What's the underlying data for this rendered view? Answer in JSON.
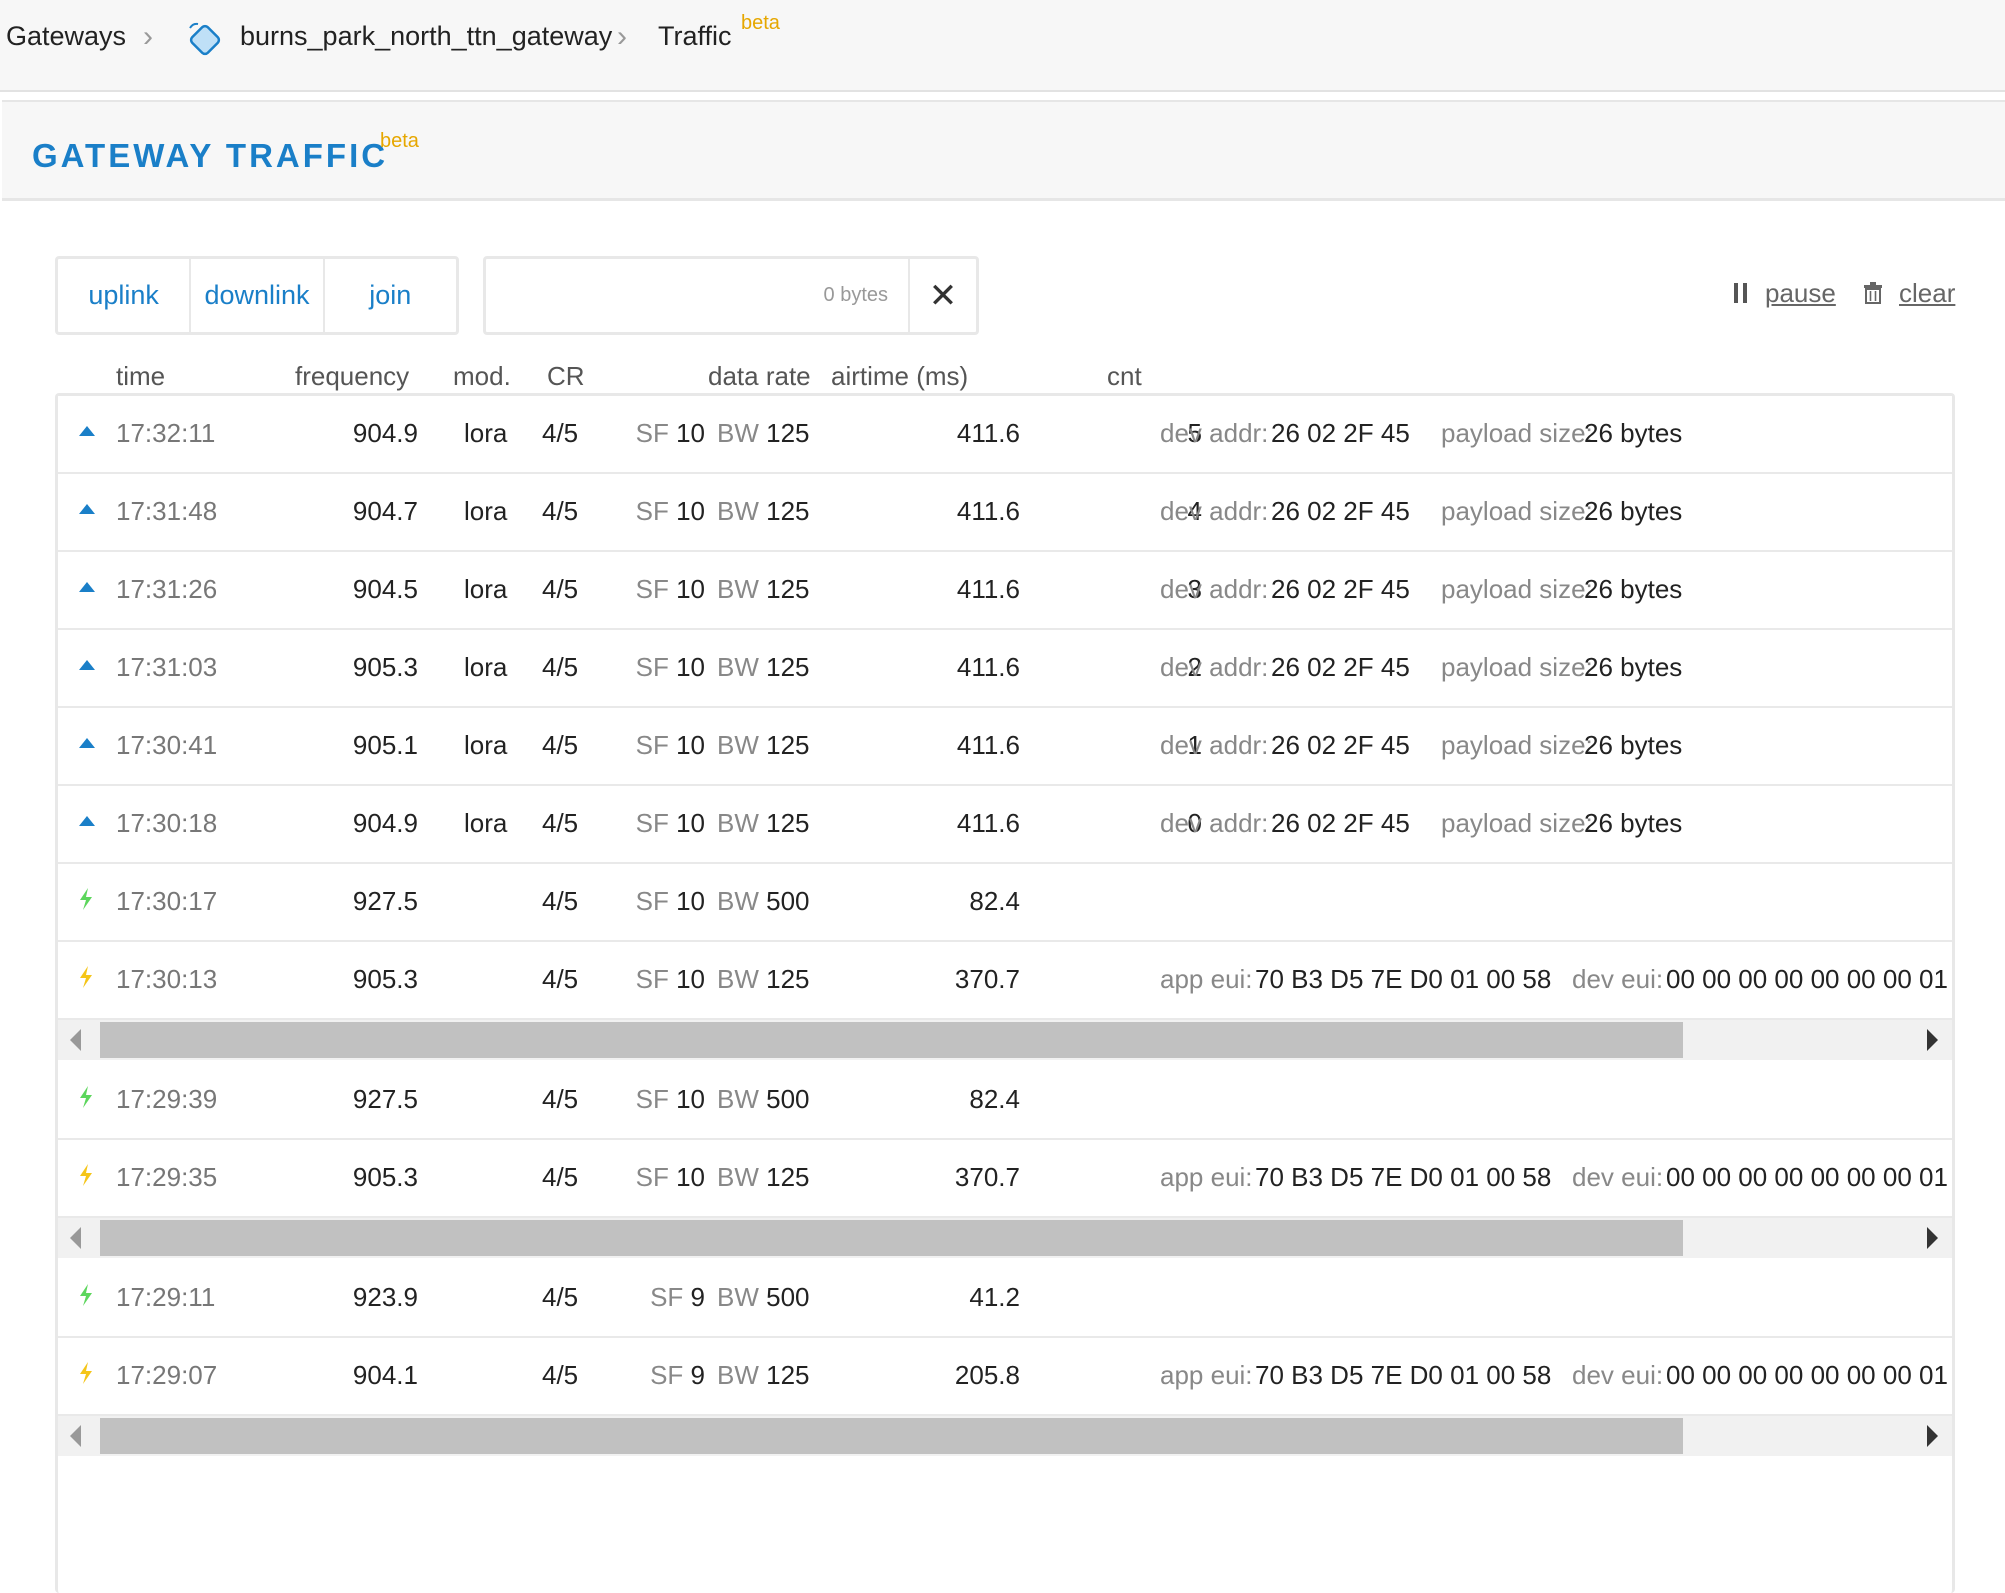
{
  "breadcrumb": {
    "gateways": "Gateways",
    "gateway_id": "burns_park_north_ttn_gateway",
    "traffic": "Traffic",
    "beta": "beta"
  },
  "header": {
    "title": "GATEWAY TRAFFIC",
    "beta": "beta"
  },
  "filters": {
    "uplink": "uplink",
    "downlink": "downlink",
    "join": "join"
  },
  "search": {
    "placeholder": "0 bytes"
  },
  "actions": {
    "pause": "pause",
    "clear": "clear"
  },
  "columns": {
    "time": "time",
    "frequency": "frequency",
    "mod": "mod.",
    "cr": "CR",
    "data_rate": "data rate",
    "airtime": "airtime (ms)",
    "cnt": "cnt"
  },
  "labels": {
    "sf": "SF",
    "bw": "BW",
    "dev_addr": "dev addr:",
    "payload_size": "payload size:",
    "app_eui": "app eui:",
    "dev_eui": "dev eui:"
  },
  "icons": {
    "uplink": "uplink-triangle-icon",
    "downlink": "downlink-bolt-icon",
    "join": "join-bolt-icon",
    "pause": "pause-icon",
    "clear": "trash-icon",
    "close": "close-icon",
    "gateway": "gateway-icon"
  },
  "colors": {
    "accent": "#1a7fc8",
    "beta": "#e6a700",
    "downlink": "#5cd65c",
    "join": "#f5c518"
  },
  "rows": [
    {
      "type": "uplink",
      "time": "17:32:11",
      "frequency": "904.9",
      "mod": "lora",
      "cr": "4/5",
      "sf": "10",
      "bw": "125",
      "airtime": "411.6",
      "cnt": "5",
      "dev_addr": "26 02 2F 45",
      "payload_size": "26 bytes"
    },
    {
      "type": "uplink",
      "time": "17:31:48",
      "frequency": "904.7",
      "mod": "lora",
      "cr": "4/5",
      "sf": "10",
      "bw": "125",
      "airtime": "411.6",
      "cnt": "4",
      "dev_addr": "26 02 2F 45",
      "payload_size": "26 bytes"
    },
    {
      "type": "uplink",
      "time": "17:31:26",
      "frequency": "904.5",
      "mod": "lora",
      "cr": "4/5",
      "sf": "10",
      "bw": "125",
      "airtime": "411.6",
      "cnt": "3",
      "dev_addr": "26 02 2F 45",
      "payload_size": "26 bytes"
    },
    {
      "type": "uplink",
      "time": "17:31:03",
      "frequency": "905.3",
      "mod": "lora",
      "cr": "4/5",
      "sf": "10",
      "bw": "125",
      "airtime": "411.6",
      "cnt": "2",
      "dev_addr": "26 02 2F 45",
      "payload_size": "26 bytes"
    },
    {
      "type": "uplink",
      "time": "17:30:41",
      "frequency": "905.1",
      "mod": "lora",
      "cr": "4/5",
      "sf": "10",
      "bw": "125",
      "airtime": "411.6",
      "cnt": "1",
      "dev_addr": "26 02 2F 45",
      "payload_size": "26 bytes"
    },
    {
      "type": "uplink",
      "time": "17:30:18",
      "frequency": "904.9",
      "mod": "lora",
      "cr": "4/5",
      "sf": "10",
      "bw": "125",
      "airtime": "411.6",
      "cnt": "0",
      "dev_addr": "26 02 2F 45",
      "payload_size": "26 bytes"
    },
    {
      "type": "downlink",
      "time": "17:30:17",
      "frequency": "927.5",
      "cr": "4/5",
      "sf": "10",
      "bw": "500",
      "airtime": "82.4"
    },
    {
      "type": "join",
      "time": "17:30:13",
      "frequency": "905.3",
      "cr": "4/5",
      "sf": "10",
      "bw": "125",
      "airtime": "370.7",
      "app_eui": "70 B3 D5 7E D0 01 00 58",
      "dev_eui": "00 00 00 00 00 00 00 01"
    },
    {
      "type": "downlink",
      "time": "17:29:39",
      "frequency": "927.5",
      "cr": "4/5",
      "sf": "10",
      "bw": "500",
      "airtime": "82.4"
    },
    {
      "type": "join",
      "time": "17:29:35",
      "frequency": "905.3",
      "cr": "4/5",
      "sf": "10",
      "bw": "125",
      "airtime": "370.7",
      "app_eui": "70 B3 D5 7E D0 01 00 58",
      "dev_eui": "00 00 00 00 00 00 00 01"
    },
    {
      "type": "downlink",
      "time": "17:29:11",
      "frequency": "923.9",
      "cr": "4/5",
      "sf": "9",
      "bw": "500",
      "airtime": "41.2"
    },
    {
      "type": "join",
      "time": "17:29:07",
      "frequency": "904.1",
      "cr": "4/5",
      "sf": "9",
      "bw": "125",
      "airtime": "205.8",
      "app_eui": "70 B3 D5 7E D0 01 00 58",
      "dev_eui": "00 00 00 00 00 00 00 01"
    }
  ]
}
